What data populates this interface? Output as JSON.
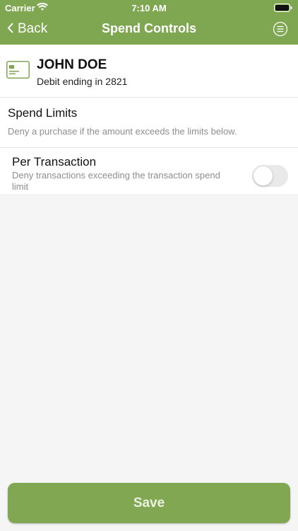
{
  "status": {
    "carrier": "Carrier",
    "time": "7:10 AM"
  },
  "nav": {
    "back_label": "Back",
    "title": "Spend Controls"
  },
  "card": {
    "holder": "JOHN DOE",
    "description": "Debit ending in 2821"
  },
  "spend_limits": {
    "title": "Spend Limits",
    "subtitle": "Deny a purchase if the amount exceeds the limits below."
  },
  "per_transaction": {
    "title": "Per Transaction",
    "subtitle": "Deny transactions exceeding the transaction spend limit",
    "enabled": false
  },
  "actions": {
    "save_label": "Save"
  },
  "colors": {
    "brand": "#7fa650",
    "save_button": "#82a752",
    "background": "#f5f5f5"
  },
  "icons": [
    "wifi-icon",
    "battery-icon",
    "chevron-left-icon",
    "menu-icon",
    "card-icon"
  ]
}
